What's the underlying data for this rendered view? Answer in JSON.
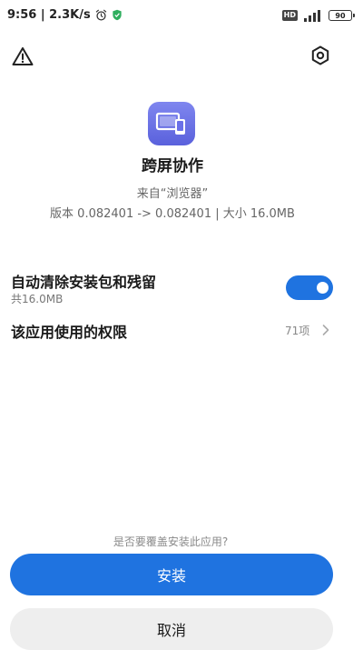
{
  "status_bar": {
    "time_speed": "9:56 | 2.3K/s",
    "hd_badge": "HD",
    "battery": "90"
  },
  "header": {
    "warning_icon": "warning-triangle-icon",
    "settings_icon": "hexagon-settings-icon"
  },
  "app": {
    "icon": "screen-collaboration-icon",
    "name": "跨屏协作",
    "source": "来自“浏览器”",
    "version_line": "版本 0.082401 -> 0.082401 | 大小 16.0MB"
  },
  "options": {
    "cleanup": {
      "title": "自动清除安装包和残留",
      "subtitle": "共16.0MB",
      "enabled": true
    },
    "permissions": {
      "title": "该应用使用的权限",
      "count": "71项"
    }
  },
  "footer": {
    "question": "是否要覆盖安装此应用?",
    "install_label": "安装",
    "cancel_label": "取消"
  },
  "colors": {
    "accent": "#1f73e0",
    "app_icon": "#6a70e8",
    "cancel_bg": "#eeeeee"
  }
}
